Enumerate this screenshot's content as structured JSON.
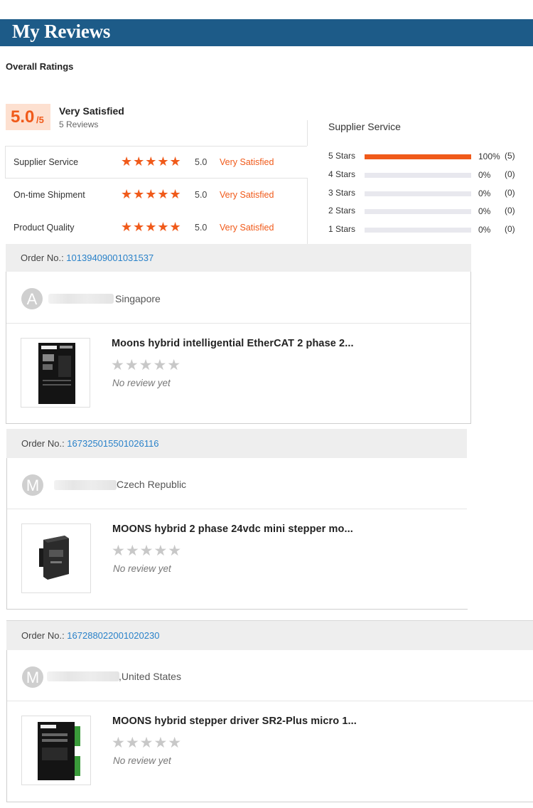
{
  "header": {
    "title": "My Reviews"
  },
  "overall": {
    "label": "Overall Ratings",
    "score": "5.0",
    "score_suffix": "/5",
    "satisfaction": "Very Satisfied",
    "review_count": "5 Reviews"
  },
  "ratings": [
    {
      "label": "Supplier Service",
      "stars": "★★★★★",
      "score": "5.0",
      "text": "Very Satisfied"
    },
    {
      "label": "On-time Shipment",
      "stars": "★★★★★",
      "score": "5.0",
      "text": "Very Satisfied"
    },
    {
      "label": "Product Quality",
      "stars": "★★★★★",
      "score": "5.0",
      "text": "Very Satisfied"
    }
  ],
  "supplier_service": {
    "title": "Supplier Service",
    "rows": [
      {
        "label": "5 Stars",
        "percent": "100%",
        "count": "(5)",
        "fraction": 1.0
      },
      {
        "label": "4 Stars",
        "percent": "0%",
        "count": "(0)",
        "fraction": 0
      },
      {
        "label": "3 Stars",
        "percent": "0%",
        "count": "(0)",
        "fraction": 0
      },
      {
        "label": "2 Stars",
        "percent": "0%",
        "count": "(0)",
        "fraction": 0
      },
      {
        "label": "1 Stars",
        "percent": "0%",
        "count": "(0)",
        "fraction": 0
      }
    ]
  },
  "orders": [
    {
      "order_label": "Order No.: ",
      "order_no": "10139409001031537",
      "avatar_letter": "A",
      "country": "Singapore",
      "product_name": "Moons hybrid intelligential EtherCAT 2 phase 2...",
      "rating_stars": "★★★★★",
      "review_status": "No review yet"
    },
    {
      "order_label": "Order No.: ",
      "order_no": "167325015501026116",
      "avatar_letter": "M",
      "country": "Czech Republic",
      "product_name": "MOONS hybrid 2 phase 24vdc mini stepper mo...",
      "rating_stars": "★★★★★",
      "review_status": "No review yet"
    },
    {
      "order_label": "Order No.: ",
      "order_no": "167288022001020230",
      "avatar_letter": "M",
      "country": ",United States",
      "product_name": "MOONS hybrid stepper driver SR2-Plus micro 1...",
      "rating_stars": "★★★★★",
      "review_status": "No review yet"
    }
  ],
  "colors": {
    "header": "#1d5b88",
    "accent": "#f05a1a",
    "link": "#2a82c9"
  }
}
